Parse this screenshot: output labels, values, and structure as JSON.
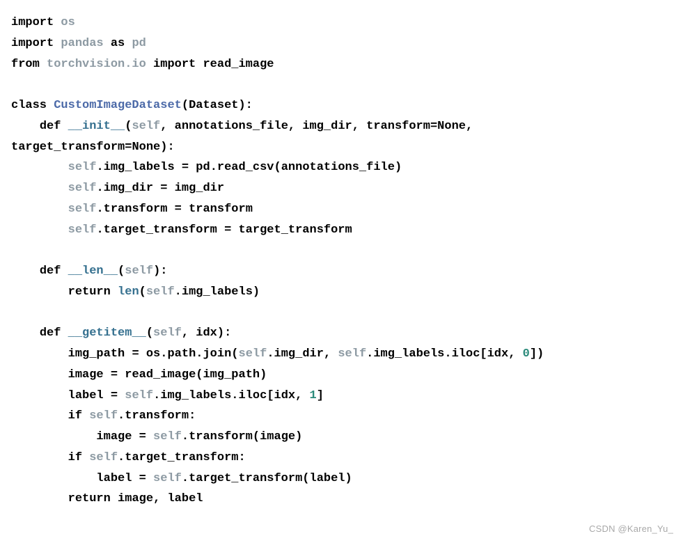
{
  "code": {
    "line1": {
      "kw_import": "import",
      "mod": "os"
    },
    "line2": {
      "kw_import": "import",
      "mod": "pandas",
      "kw_as": "as",
      "alias": "pd"
    },
    "line3": {
      "kw_from": "from",
      "mod": "torchvision.io",
      "kw_import": "import",
      "name": "read_image"
    },
    "line5": {
      "kw_class": "class",
      "class_name": "CustomImageDataset",
      "base": "Dataset"
    },
    "line6": {
      "kw_def": "def",
      "fn": "__init__",
      "self": "self",
      "p1": "annotations_file",
      "p2": "img_dir",
      "p3": "transform",
      "p3_default": "None"
    },
    "line7": {
      "p4": "target_transform",
      "p4_default": "None"
    },
    "line8": {
      "self": "self",
      "attr": "img_labels",
      "rhs_mod": "pd",
      "rhs_fn": "read_csv",
      "rhs_arg": "annotations_file"
    },
    "line9": {
      "self": "self",
      "attr": "img_dir",
      "rhs": "img_dir"
    },
    "line10": {
      "self": "self",
      "attr": "transform",
      "rhs": "transform"
    },
    "line11": {
      "self": "self",
      "attr": "target_transform",
      "rhs": "target_transform"
    },
    "line13": {
      "kw_def": "def",
      "fn": "__len__",
      "self": "self"
    },
    "line14": {
      "kw_return": "return",
      "bi": "len",
      "self": "self",
      "attr": "img_labels"
    },
    "line16": {
      "kw_def": "def",
      "fn": "__getitem__",
      "self": "self",
      "p1": "idx"
    },
    "line17": {
      "lhs": "img_path",
      "mod1": "os",
      "attr1": "path",
      "fn": "join",
      "self1": "self",
      "a1": "img_dir",
      "self2": "self",
      "a2": "img_labels",
      "a3": "iloc",
      "idx": "idx",
      "zero": "0"
    },
    "line18": {
      "lhs": "image",
      "fn": "read_image",
      "arg": "img_path"
    },
    "line19": {
      "lhs": "label",
      "self": "self",
      "a1": "img_labels",
      "a2": "iloc",
      "idx": "idx",
      "one": "1"
    },
    "line20": {
      "kw_if": "if",
      "self": "self",
      "attr": "transform"
    },
    "line21": {
      "lhs": "image",
      "self": "self",
      "fn": "transform",
      "arg": "image"
    },
    "line22": {
      "kw_if": "if",
      "self": "self",
      "attr": "target_transform"
    },
    "line23": {
      "lhs": "label",
      "self": "self",
      "fn": "target_transform",
      "arg": "label"
    },
    "line24": {
      "kw_return": "return",
      "v1": "image",
      "v2": "label"
    }
  },
  "watermark": "CSDN @Karen_Yu_"
}
